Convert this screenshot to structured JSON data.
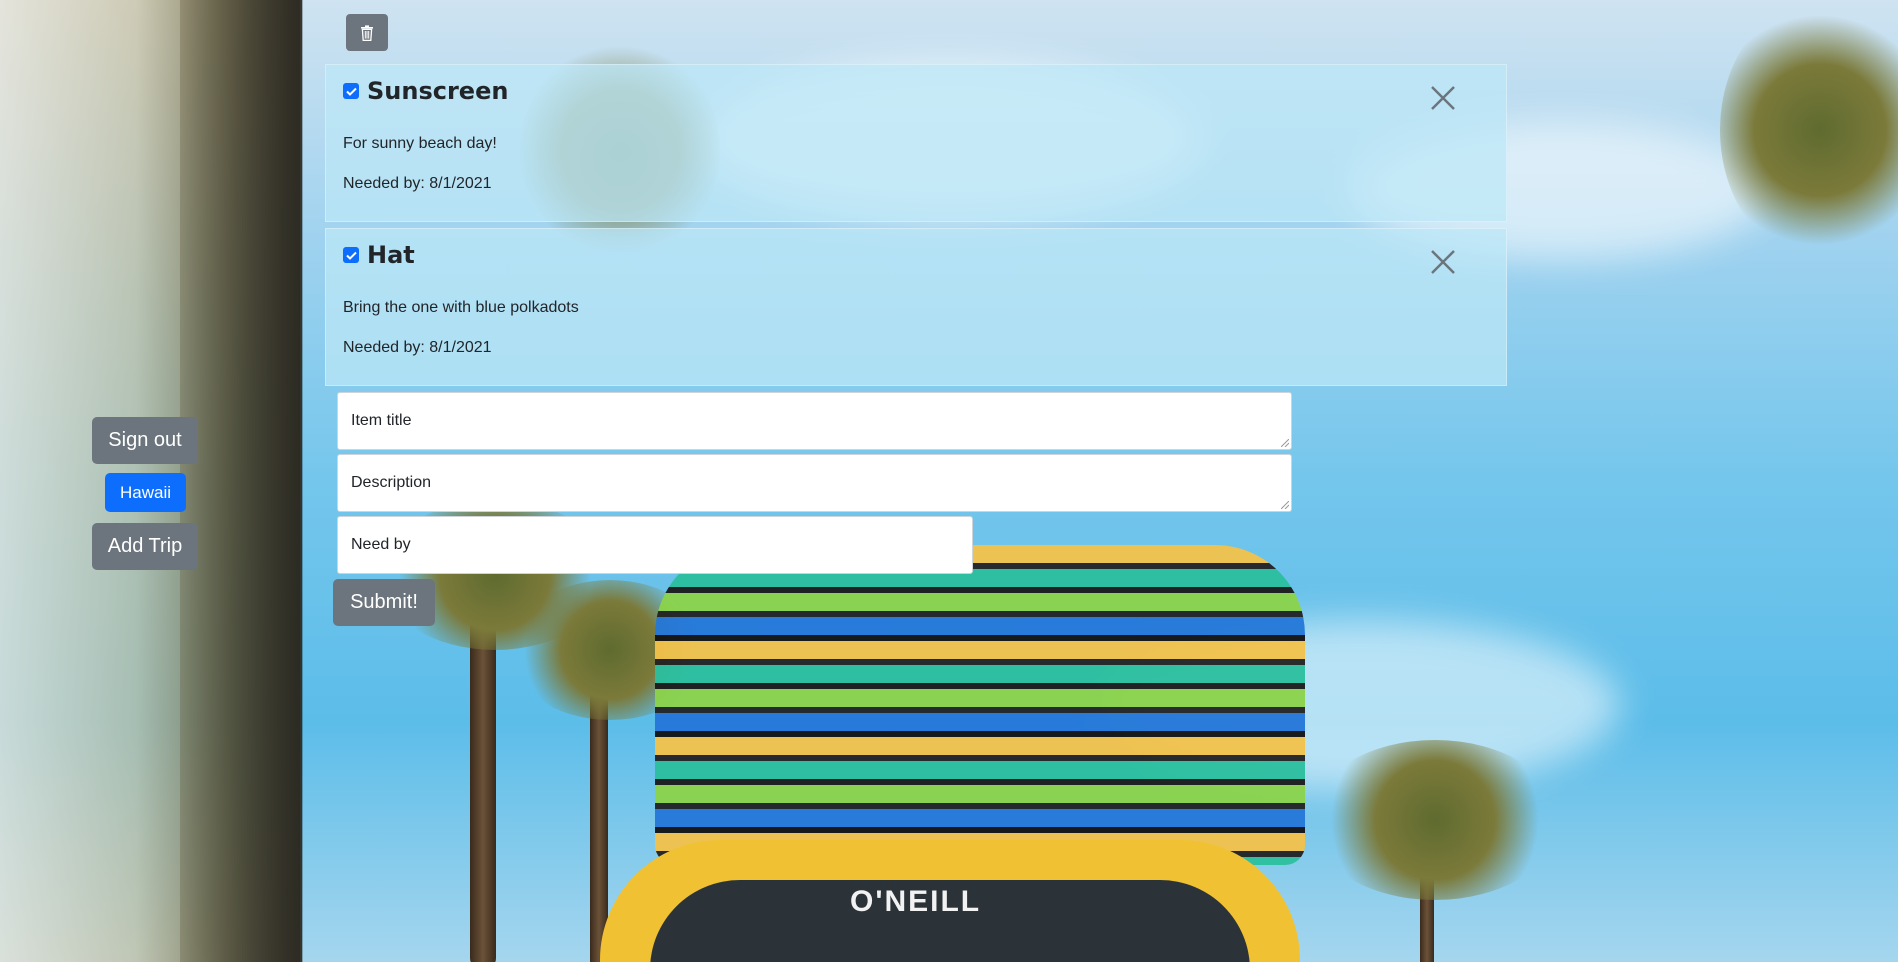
{
  "sidebar": {
    "sign_out_label": "Sign out",
    "trip_label": "Hawaii",
    "add_trip_label": "Add Trip"
  },
  "toolbar": {
    "delete_icon": "trash-icon"
  },
  "items": [
    {
      "title": "Sunscreen",
      "checked": true,
      "description": "For sunny beach day!",
      "needed_by": "Needed by: 8/1/2021"
    },
    {
      "title": "Hat",
      "checked": true,
      "description": "Bring the one with blue polkadots",
      "needed_by": "Needed by: 8/1/2021"
    }
  ],
  "form": {
    "title_placeholder": "Item title",
    "description_placeholder": "Description",
    "need_by_placeholder": "Need by",
    "submit_label": "Submit!"
  },
  "background": {
    "van_brand": "O'NEILL"
  },
  "colors": {
    "primary": "#0d6efd",
    "secondary": "#6c757d"
  }
}
